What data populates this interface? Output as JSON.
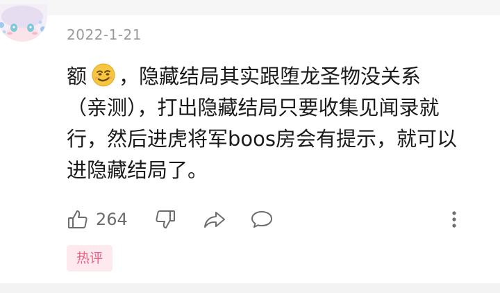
{
  "comment": {
    "date": "2022-1-21",
    "lines": [
      {
        "pre": "额",
        "post": "，隐藏结局其实跟堕龙圣物没关系"
      },
      {
        "text": "（亲测），打出隐藏结局只要收集见闻录就"
      },
      {
        "text": "行，然后进虎将军boos房会有提示，就可以"
      },
      {
        "text": "进隐藏结局了。"
      }
    ],
    "emoji_icon": "smirk-emoji-icon",
    "likes": "264",
    "tag": "热评"
  },
  "icons": [
    "thumbs-up-icon",
    "thumbs-down-icon",
    "share-icon",
    "comment-icon",
    "more-vertical-icon"
  ],
  "colors": {
    "tag_bg": "#fde9ee",
    "tag_text": "#ea6286",
    "meta_text": "#9a9a9a",
    "icon": "#6c6c6c"
  }
}
